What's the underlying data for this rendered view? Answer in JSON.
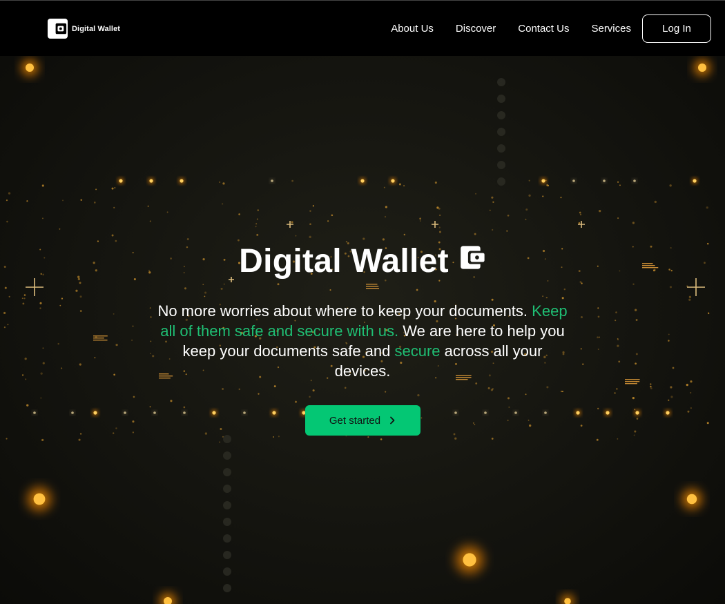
{
  "brand": {
    "name": "Digital Wallet"
  },
  "nav": {
    "links": [
      "About Us",
      "Discover",
      "Contact Us",
      "Services"
    ],
    "login_label": "Log In"
  },
  "hero": {
    "title": "Digital Wallet",
    "text_1": "No more worries about where to keep your documents.",
    "text_2_accent": "Keep all of them safe and secure with us.",
    "text_3": " We are here to help you keep your documents safe and ",
    "text_4_accent": "secure",
    "text_5": " across all your devices.",
    "cta_label": "Get started"
  },
  "colors": {
    "accent": "#1fbf74",
    "cta": "#04c774",
    "glow": "#ffb020"
  },
  "icons": {
    "logo": "wallet-icon",
    "title": "wallet-icon",
    "cta": "chevron-right-icon"
  }
}
